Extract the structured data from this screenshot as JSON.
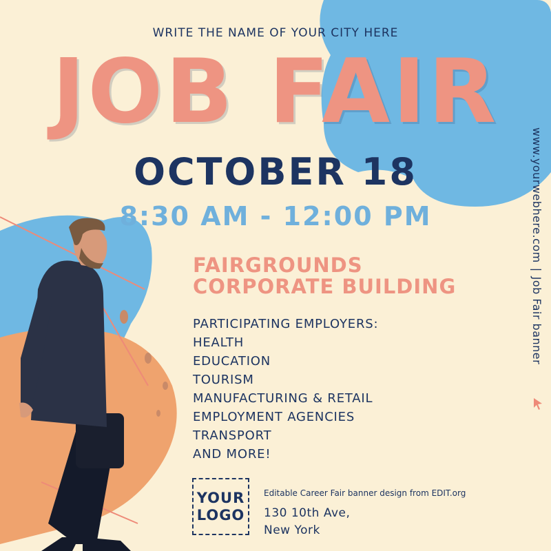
{
  "city_line": "WRITE THE NAME OF YOUR CITY HERE",
  "title": "JOB FAIR",
  "date": "OCTOBER 18",
  "time": "8:30 AM - 12:00 PM",
  "venue": {
    "line1": "FAIRGROUNDS",
    "line2": "CORPORATE BUILDING"
  },
  "employers": {
    "heading": "PARTICIPATING EMPLOYERS:",
    "items": [
      "HEALTH",
      "EDUCATION",
      "TOURISM",
      "MANUFACTURING & RETAIL",
      "EMPLOYMENT AGENCIES",
      "TRANSPORT",
      "AND MORE!"
    ]
  },
  "logo": {
    "line1": "YOUR",
    "line2": "LOGO"
  },
  "credit": "Editable Career Fair banner design from EDIT.org",
  "address": {
    "line1": "130 10th Ave,",
    "line2": "New York"
  },
  "side": {
    "label": "Job Fair banner",
    "separator": "|",
    "url": "www.yourwebhere.com"
  },
  "icons": {
    "pointer": "cursor-arrow-icon"
  },
  "colors": {
    "background": "#FBF0D6",
    "navy": "#1D3461",
    "salmon": "#EE9482",
    "sky_blue": "#6FB0DC",
    "orange": "#EEA36E"
  }
}
